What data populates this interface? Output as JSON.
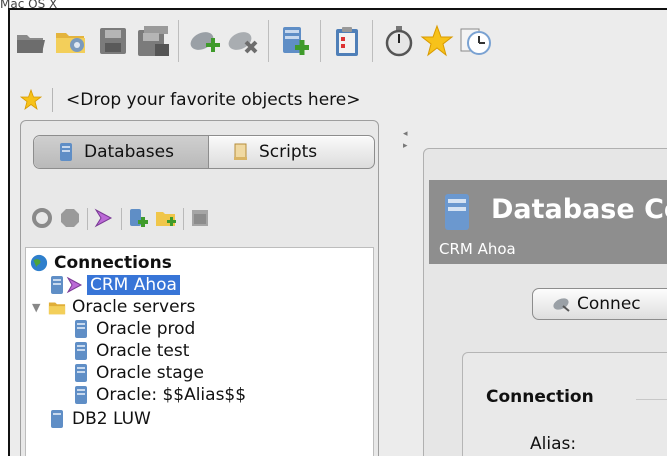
{
  "window": {
    "title_fragment": "Mac OS X"
  },
  "toolbar": {
    "buttons": [
      {
        "icon": "open-folder-icon"
      },
      {
        "icon": "gear-folder-icon"
      },
      {
        "icon": "save-icon"
      },
      {
        "icon": "save-all-icon"
      },
      {
        "icon": "connect-plug-icon"
      },
      {
        "icon": "disconnect-plug-icon"
      },
      {
        "icon": "add-database-icon"
      },
      {
        "icon": "clipboard-icon"
      },
      {
        "icon": "stopwatch-icon"
      },
      {
        "icon": "favorite-star-icon"
      },
      {
        "icon": "history-icon"
      }
    ]
  },
  "favorites": {
    "placeholder": "<Drop your favorite objects here>"
  },
  "left_panel": {
    "tabs": [
      {
        "label": "Databases",
        "icon": "database-icon",
        "selected": true
      },
      {
        "label": "Scripts",
        "icon": "script-icon",
        "selected": false
      }
    ],
    "tools": [
      {
        "icon": "refresh-icon"
      },
      {
        "icon": "stop-icon"
      },
      {
        "icon": "connect-icon"
      },
      {
        "icon": "new-database-icon"
      },
      {
        "icon": "new-folder-icon"
      },
      {
        "icon": "window-icon"
      }
    ],
    "tree": {
      "root": "Connections",
      "items": [
        {
          "label": "CRM Ahoa",
          "selected": true
        },
        {
          "label": "Oracle servers",
          "type": "folder",
          "expanded": true
        },
        {
          "label": "Oracle prod"
        },
        {
          "label": "Oracle test"
        },
        {
          "label": "Oracle stage"
        },
        {
          "label": "Oracle: $$Alias$$"
        },
        {
          "label": "DB2 LUW"
        }
      ]
    }
  },
  "right_panel": {
    "banner_title": "Database Co",
    "banner_subtitle": "CRM Ahoa",
    "connect_button": "Connec",
    "section_title": "Connection",
    "alias_label": "Alias:"
  }
}
